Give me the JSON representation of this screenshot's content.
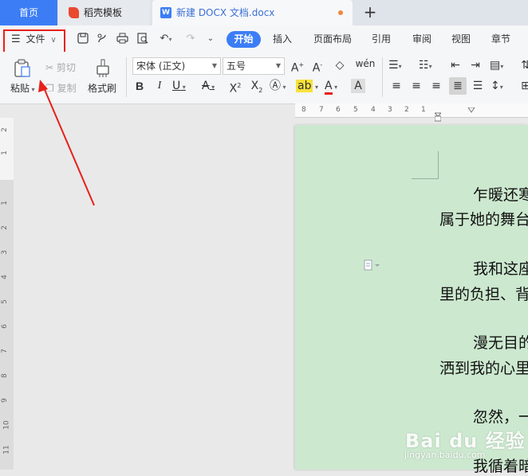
{
  "tabs": {
    "home": "首页",
    "docer": "稻壳模板",
    "document": "新建 DOCX 文档.docx",
    "new_tab_symbol": "+"
  },
  "menu": {
    "file": "文件",
    "tabs": [
      "开始",
      "插入",
      "页面布局",
      "引用",
      "审阅",
      "视图",
      "章节"
    ]
  },
  "ribbon": {
    "paste": "粘贴",
    "cut": "剪切",
    "copy": "复制",
    "format_painter": "格式刷",
    "font_name": "宋体 (正文)",
    "font_size": "五号",
    "bold": "B",
    "italic": "I",
    "underline": "U",
    "font_color_letter": "A"
  },
  "ruler": {
    "horizontal": [
      "8",
      "7",
      "6",
      "5",
      "4",
      "3",
      "2",
      "1"
    ],
    "vertical": [
      "2",
      "1",
      "1",
      "2",
      "3",
      "4",
      "5",
      "6",
      "7",
      "8",
      "9",
      "10",
      "11"
    ]
  },
  "document": {
    "paragraphs": [
      {
        "line1": "乍暖还寒",
        "line2": "属于她的舞台"
      },
      {
        "line1": "我和这座",
        "line2": "里的负担、背"
      },
      {
        "line1": "漫无目的",
        "line2": "洒到我的心里"
      },
      {
        "line1": "忽然，一",
        "line2": "我循着暗"
      }
    ]
  },
  "watermark": {
    "brand": "Bai du 经验",
    "url": "jingyan.baidu.com"
  },
  "colors": {
    "accent": "#3c7df5",
    "highlight": "#e8201a",
    "page_background": "#cce8cf"
  }
}
